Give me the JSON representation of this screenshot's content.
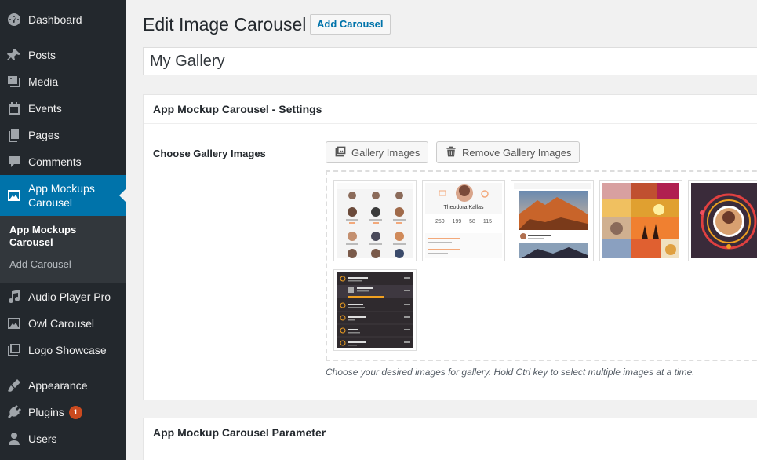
{
  "sidebar": {
    "items": [
      {
        "label": "Dashboard",
        "icon": "dashboard-icon"
      },
      {
        "label": "Posts",
        "icon": "pin-icon"
      },
      {
        "label": "Media",
        "icon": "media-icon"
      },
      {
        "label": "Events",
        "icon": "calendar-icon"
      },
      {
        "label": "Pages",
        "icon": "pages-icon"
      },
      {
        "label": "Comments",
        "icon": "comment-icon"
      },
      {
        "label": "App Mockups Carousel",
        "icon": "image-icon"
      },
      {
        "label": "Audio Player Pro",
        "icon": "music-icon"
      },
      {
        "label": "Owl Carousel",
        "icon": "image-icon"
      },
      {
        "label": "Logo Showcase",
        "icon": "gallery-icon"
      },
      {
        "label": "Appearance",
        "icon": "brush-icon"
      },
      {
        "label": "Plugins",
        "icon": "plugin-icon"
      },
      {
        "label": "Users",
        "icon": "user-icon"
      }
    ],
    "submenu": {
      "current": "App Mockups Carousel",
      "add": "Add Carousel"
    },
    "plugins_badge": "1"
  },
  "header": {
    "title": "Edit Image Carousel",
    "add_button": "Add Carousel"
  },
  "post_title": "My Gallery",
  "settings_box": {
    "title": "App Mockup Carousel - Settings",
    "field_label": "Choose Gallery Images",
    "gallery_button": "Gallery Images",
    "remove_button": "Remove Gallery Images",
    "description": "Choose your desired images for gallery. Hold Ctrl key to select multiple images at a time.",
    "thumb2": {
      "name": "Theodora Kallas",
      "stats": [
        "250",
        "199",
        "58",
        "115"
      ]
    }
  },
  "parameter_box": {
    "title": "App Mockup Carousel Parameter"
  },
  "colors": {
    "sidebar_bg": "#23282d",
    "active_bg": "#0073aa",
    "submenu_bg": "#32373c",
    "link_blue": "#0073aa",
    "badge": "#ca4a1f"
  }
}
